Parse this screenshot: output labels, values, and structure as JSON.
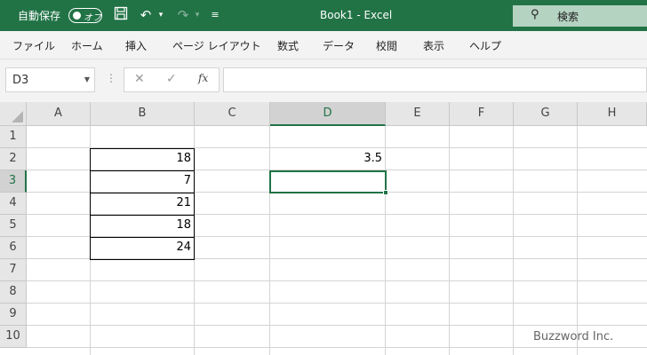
{
  "titlebar": {
    "autosave_label": "自動保存",
    "autosave_state": "オフ",
    "doc_title": "Book1  -  Excel",
    "search_label": "検索",
    "icons": [
      "save-icon",
      "undo-icon",
      "redo-icon",
      "customize-qat-icon",
      "search-icon"
    ]
  },
  "ribbon": {
    "tabs": [
      "ファイル",
      "ホーム",
      "挿入",
      "ページ レイアウト",
      "数式",
      "データ",
      "校閲",
      "表示",
      "ヘルプ"
    ]
  },
  "formula_bar": {
    "name_box": "D3",
    "fx_label": "fx",
    "cancel_glyph": "✕",
    "enter_glyph": "✓",
    "content": ""
  },
  "sheet": {
    "columns": [
      "A",
      "B",
      "C",
      "D",
      "E",
      "F",
      "G",
      "H"
    ],
    "rows": [
      "1",
      "2",
      "3",
      "4",
      "5",
      "6",
      "7",
      "8",
      "9",
      "10"
    ],
    "selected_cell": "D3",
    "cells": {
      "B2": "18",
      "B3": "7",
      "B4": "21",
      "B5": "18",
      "B6": "24",
      "D2": "3.5"
    }
  },
  "watermark": "Buzzword Inc.",
  "colors": {
    "excel_green": "#217346",
    "search_box": "#b5d3c1",
    "ribbon_bg": "#f3f3f3",
    "header_bg": "#e6e6e6"
  }
}
